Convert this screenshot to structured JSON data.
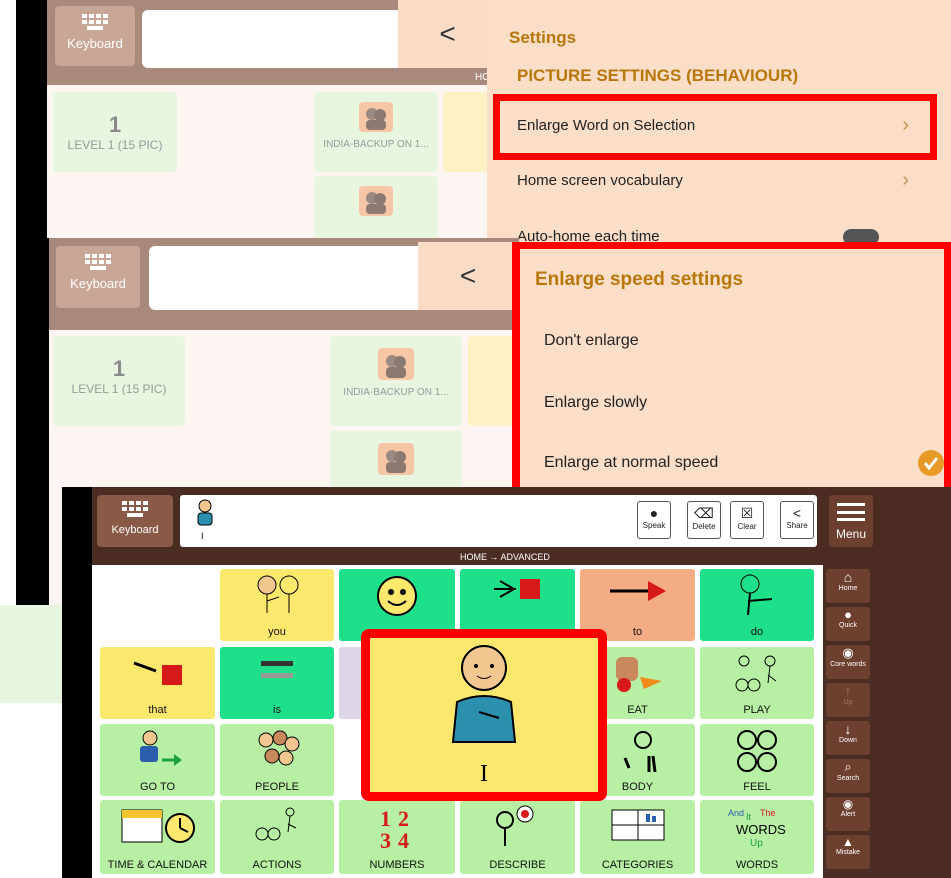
{
  "keyboard_label": "Keyboard",
  "back_glyph": "<",
  "breadcrumb_faded": "HOME",
  "level_tile": {
    "number": "1",
    "label": "LEVEL 1 (15 PIC)"
  },
  "india_tile": "INDIA-BACKUP ON 1...",
  "india_tile_2": "INDIA-BACKUP ON 1...",
  "settings": {
    "title": "Settings",
    "section": "PICTURE SETTINGS (BEHAVIOUR)",
    "rows": [
      "Enlarge Word on Selection",
      "Home screen vocabulary",
      "Auto-home each time"
    ]
  },
  "enlarge_dialog": {
    "title": "Enlarge speed settings",
    "options": [
      "Don't enlarge",
      "Enlarge slowly",
      "Enlarge at normal speed"
    ],
    "selected": 2
  },
  "app": {
    "keyboard_label": "Keyboard",
    "message_word": "I",
    "toolbar": {
      "speak": "Speak",
      "delete": "Delete",
      "clear": "Clear",
      "share": "Share",
      "menu": "Menu"
    },
    "breadcrumb": "HOME → ADVANCED",
    "tiles": {
      "you": "you",
      "to": "to",
      "do": "do",
      "that": "that",
      "is": "is",
      "eat": "EAT",
      "play": "PLAY",
      "goto": "GO TO",
      "people": "PEOPLE",
      "body": "BODY",
      "feel": "FEEL",
      "time": "TIME & CALENDAR",
      "actions": "ACTIONS",
      "numbers": "NUMBERS",
      "describe": "DESCRIBE",
      "categories": "CATEGORIES",
      "words": "WORDS"
    },
    "enlarged_word": "I",
    "side": [
      "Home",
      "Quick",
      "Core words",
      "Up",
      "Down",
      "Search",
      "Alert",
      "Mistake"
    ]
  },
  "colors": {
    "accent": "#b8770a",
    "highlight": "#ff0000",
    "check": "#e89a27"
  }
}
